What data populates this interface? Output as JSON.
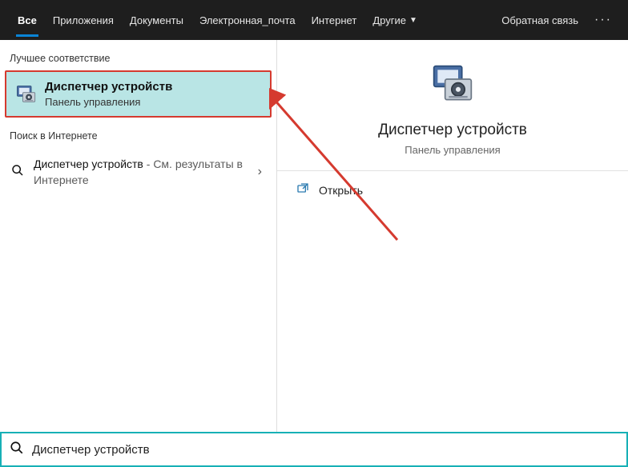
{
  "topbar": {
    "tabs": [
      {
        "label": "Все",
        "active": true
      },
      {
        "label": "Приложения"
      },
      {
        "label": "Документы"
      },
      {
        "label": "Электронная_почта"
      },
      {
        "label": "Интернет"
      },
      {
        "label": "Другие",
        "dropdown": true
      }
    ],
    "feedback": "Обратная связь",
    "more": "···"
  },
  "left": {
    "best_match_header": "Лучшее соответствие",
    "best_match": {
      "title": "Диспетчер устройств",
      "subtitle": "Панель управления",
      "icon": "device-manager-icon"
    },
    "web_header": "Поиск в Интернете",
    "web_result": {
      "title": "Диспетчер устройств",
      "suffix": " - См. результаты в Интернете",
      "icon": "search-icon"
    }
  },
  "right": {
    "preview": {
      "title": "Диспетчер устройств",
      "subtitle": "Панель управления",
      "icon": "device-manager-icon"
    },
    "actions": {
      "open": {
        "label": "Открыть",
        "icon": "open-icon"
      }
    }
  },
  "search": {
    "value": "Диспетчер устройств",
    "icon": "search-icon"
  },
  "annotation": {
    "arrow_color": "#d53a2f"
  }
}
